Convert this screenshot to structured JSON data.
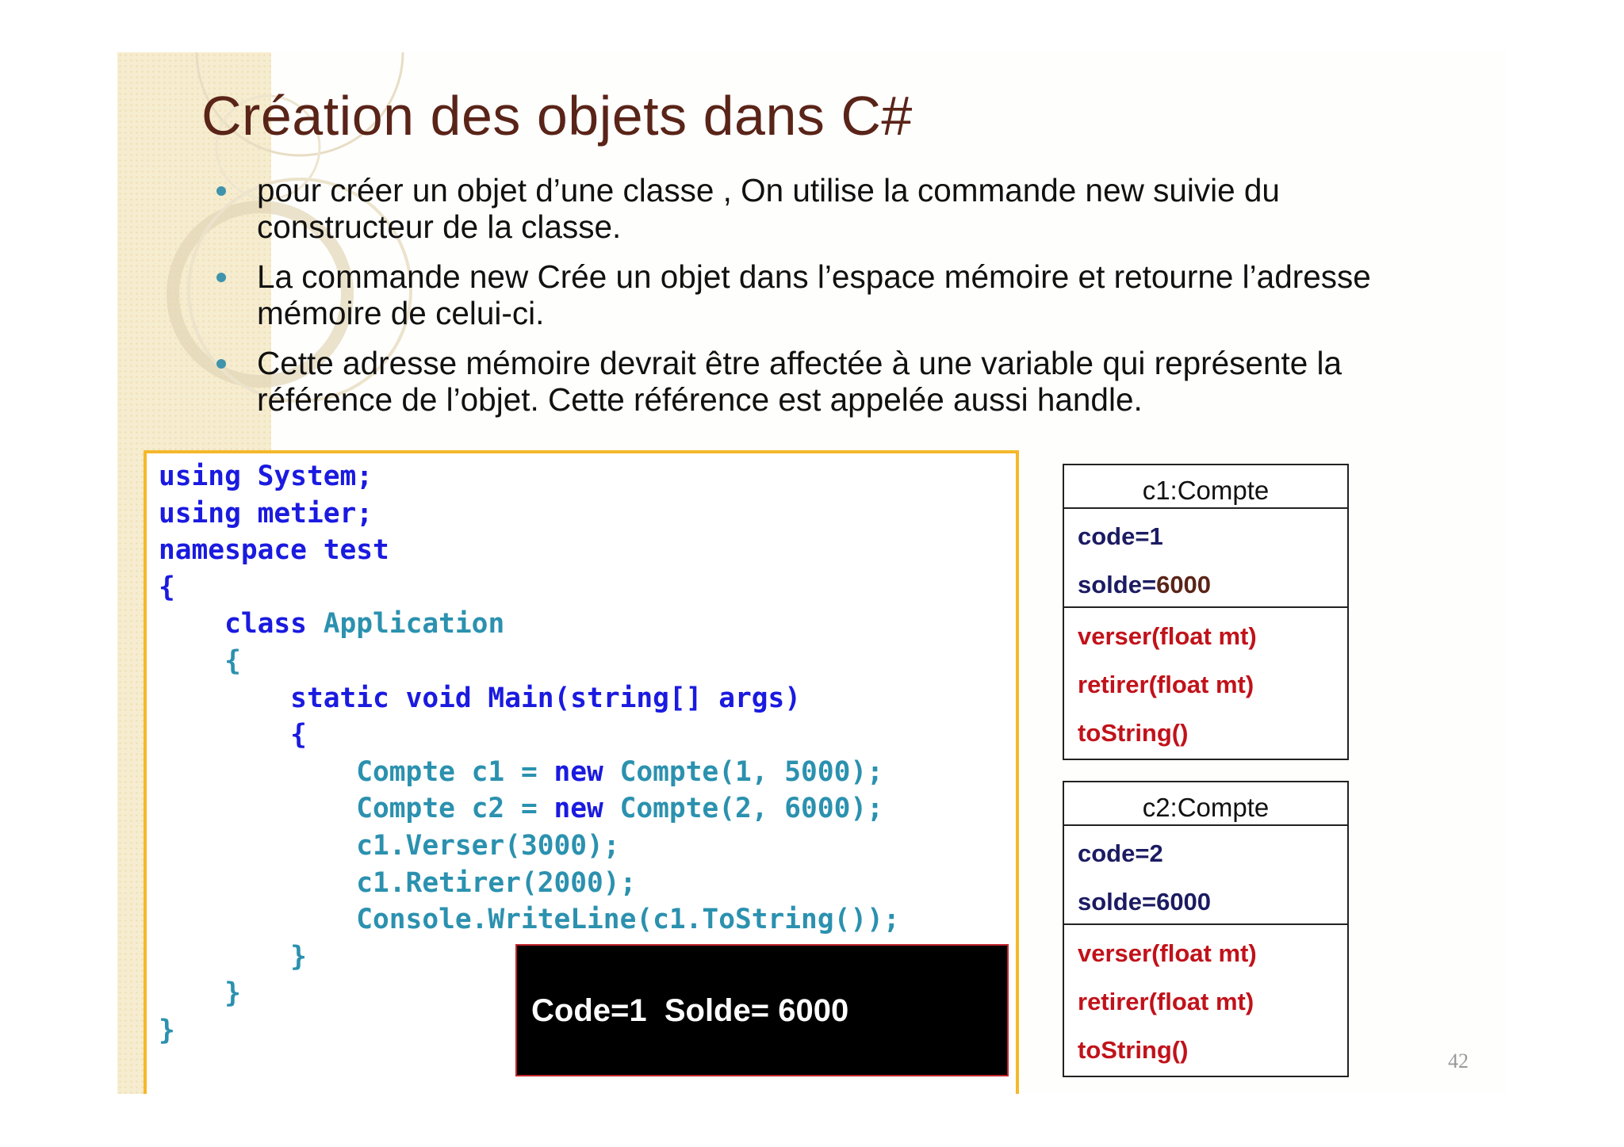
{
  "slide": {
    "title": "Création des objets dans C#",
    "bullets": [
      "pour créer un objet d’une classe , On utilise la commande new suivie du constructeur de la classe.",
      "La commande new Crée un objet dans l’espace mémoire et retourne l’adresse mémoire de celui-ci.",
      "Cette adresse mémoire devrait être affectée à une variable qui représente la référence de l’objet. Cette référence est appelée aussi handle."
    ],
    "page_number": "42"
  },
  "code": {
    "l1_kw": "using",
    "l1_rest": " System;",
    "l2_kw": "using",
    "l2_rest": " metier;",
    "l3_kw": "namespace",
    "l3_rest": " test",
    "l4": "{",
    "l5_kw": "class",
    "l5_ty": "Application",
    "l6": "{",
    "l7": "static void Main(string[] args)",
    "l8": "{",
    "l9_a": "Compte c1 = ",
    "l9_kw": "new",
    "l9_b": " Compte(1, 5000);",
    "l10_a": "Compte c2 = ",
    "l10_kw": "new",
    "l10_b": " Compte(2, 6000);",
    "l11": "c1.Verser(3000);",
    "l12": "c1.Retirer(2000);",
    "l13": "Console.WriteLine(c1.ToString());",
    "l14": "}",
    "l15": "}",
    "l16": "}"
  },
  "output": {
    "text": "Code=1  Solde= 6000"
  },
  "uml": [
    {
      "name": "c1:Compte",
      "attrs": [
        {
          "label": "code=",
          "value": "1"
        },
        {
          "label": "solde=",
          "value": "6000"
        }
      ],
      "ops": [
        "verser(float mt)",
        "retirer(float mt)",
        "toString()"
      ]
    },
    {
      "name": "c2:Compte",
      "attrs": [
        {
          "label": "code=",
          "value": "2"
        },
        {
          "label": "solde=",
          "value": "6000"
        }
      ],
      "ops": [
        "verser(float mt)",
        "retirer(float mt)",
        "toString()"
      ]
    }
  ],
  "colors": {
    "title": "#5a2418",
    "bullet": "#3f94ac",
    "code_keyword": "#1a1ae0",
    "code_type": "#2b91af",
    "code_border": "#f5b82b",
    "output_border": "#c0262c",
    "uml_attr": "#1b1b63",
    "uml_op": "#c1121a"
  }
}
